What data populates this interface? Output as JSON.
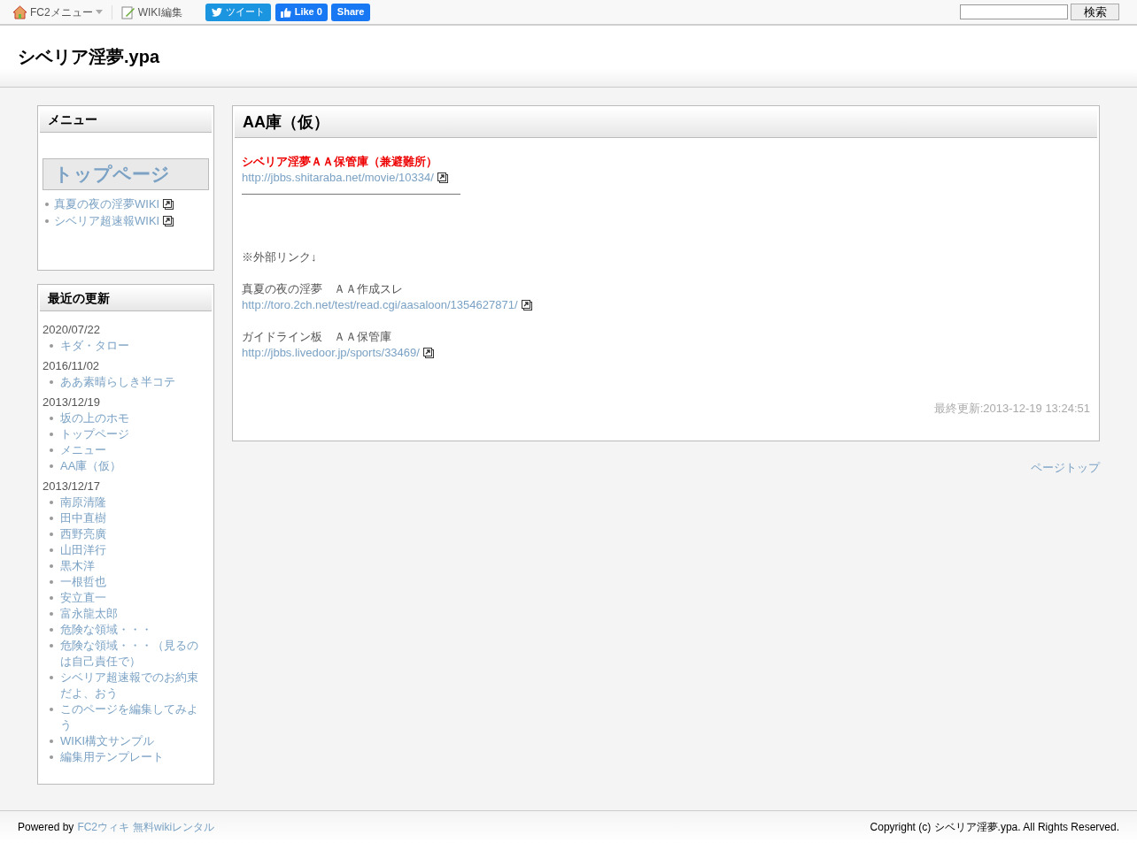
{
  "toolbar": {
    "fc2_menu": "FC2メニュー",
    "wiki_edit": "WIKI編集",
    "tweet": "ツイート",
    "like": "Like 0",
    "share": "Share",
    "search_button": "検索"
  },
  "site_title": "シベリア淫夢.ypa",
  "menu": {
    "title": "メニュー",
    "heading": "トップページ",
    "links": [
      {
        "text": "真夏の夜の淫夢WIKI",
        "external": true
      },
      {
        "text": "シベリア超速報WIKI",
        "external": true
      }
    ]
  },
  "recent": {
    "title": "最近の更新",
    "groups": [
      {
        "date": "2020/07/22",
        "pages": [
          "キダ・タロー"
        ]
      },
      {
        "date": "2016/11/02",
        "pages": [
          "ああ素晴らしき半コテ"
        ]
      },
      {
        "date": "2013/12/19",
        "pages": [
          "坂の上のホモ",
          "トップページ",
          "メニュー",
          "AA庫（仮）"
        ]
      },
      {
        "date": "2013/12/17",
        "pages": [
          "南原清隆",
          "田中直樹",
          "西野亮廣",
          "山田洋行",
          "黒木洋",
          "一根哲也",
          "安立直一",
          "富永龍太郎",
          "危険な領域・・・",
          "危険な領域・・・（見るのは自己責任で）",
          "シベリア超速報でのお約束だよ、おう",
          "このページを編集してみよう",
          "WIKI構文サンプル",
          "編集用テンプレート"
        ]
      }
    ]
  },
  "article": {
    "title": "AA庫（仮）",
    "blocks": [
      {
        "kind": "emphasis",
        "text": "シベリア淫夢ＡＡ保管庫（兼避難所）"
      },
      {
        "kind": "link",
        "text": "http://jbbs.shitaraba.net/movie/10334/",
        "external": true
      },
      {
        "kind": "rule"
      },
      {
        "kind": "text",
        "text": "※外部リンク↓"
      },
      {
        "kind": "text",
        "text": "真夏の夜の淫夢　ＡＡ作成スレ"
      },
      {
        "kind": "link",
        "text": "http://toro.2ch.net/test/read.cgi/aasaloon/1354627871/",
        "external": true
      },
      {
        "kind": "text",
        "text": "ガイドライン板　ＡＡ保管庫"
      },
      {
        "kind": "link",
        "text": "http://jbbs.livedoor.jp/sports/33469/",
        "external": true
      }
    ],
    "last_updated": "最終更新:2013-12-19 13:24:51"
  },
  "page_top": "ページトップ",
  "footer": {
    "powered_by": "Powered by",
    "links": [
      "FC2ウィキ",
      "無料wikiレンタル"
    ],
    "copyright": "Copyright (c) シベリア淫夢.ypa. All Rights Reserved."
  }
}
